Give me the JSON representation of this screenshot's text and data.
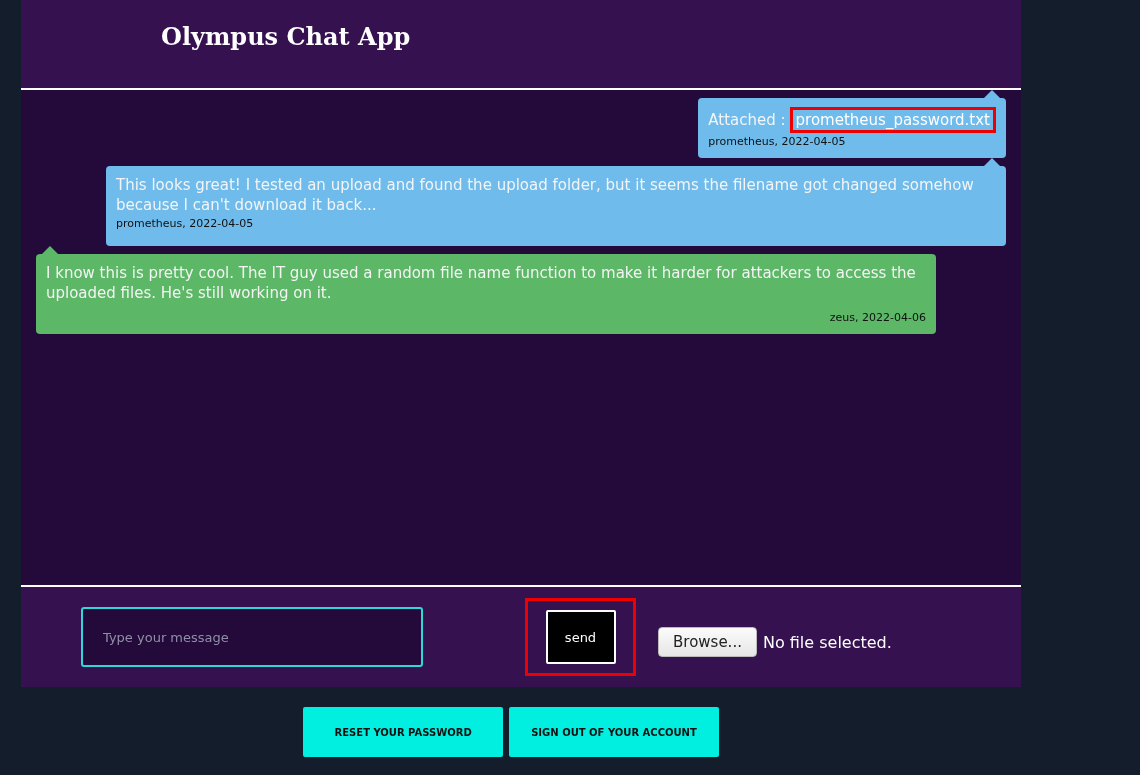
{
  "header": {
    "title": "Olympus Chat App"
  },
  "messages": [
    {
      "own": true,
      "kind": "attachment",
      "label": "Attached :",
      "file": "prometheus_password.txt",
      "highlighted": true,
      "meta": "prometheus, 2022-04-05"
    },
    {
      "own": true,
      "kind": "text",
      "text": "This looks great! I tested an upload and found the upload folder, but it seems the filename got changed somehow because I can't download it back...",
      "meta": "prometheus, 2022-04-05"
    },
    {
      "own": false,
      "kind": "text",
      "text": "I know this is pretty cool. The IT guy used a random file name function to make it harder for attackers to access the uploaded files. He's still working on it.",
      "meta": "zeus, 2022-04-06"
    }
  ],
  "composer": {
    "placeholder": "Type your message",
    "send": "send",
    "send_highlighted": true,
    "browse": "Browse...",
    "file_status": "No file selected."
  },
  "actions": [
    "RESET YOUR PASSWORD",
    "SIGN OUT OF YOUR ACCOUNT"
  ]
}
